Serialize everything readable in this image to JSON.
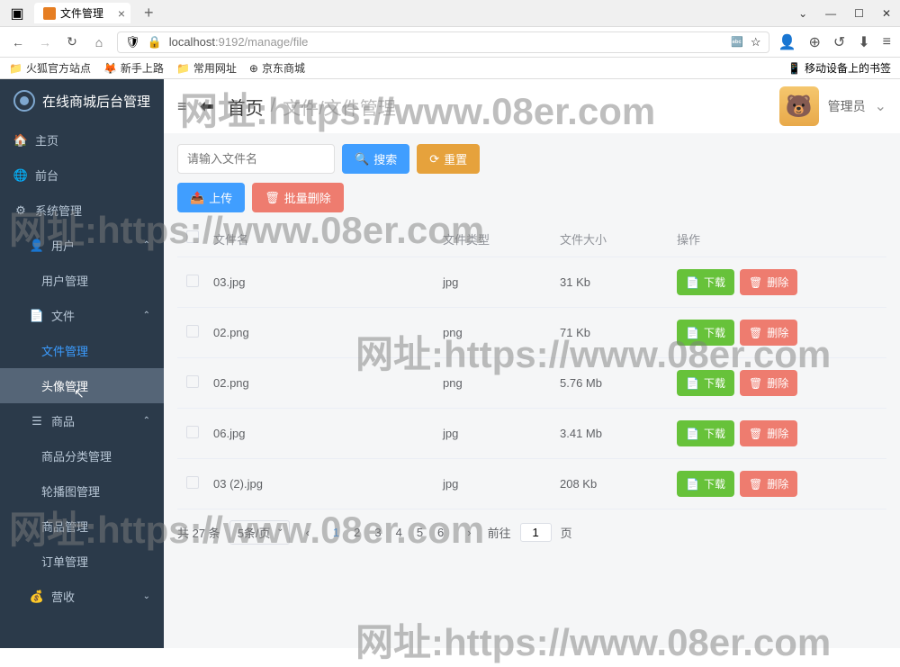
{
  "browser": {
    "tab_title": "文件管理",
    "url_prefix": "localhost",
    "url_suffix": ":9192/manage/file",
    "bookmarks": [
      "火狐官方站点",
      "新手上路",
      "常用网址",
      "京东商城"
    ],
    "bookmark_right": "移动设备上的书签"
  },
  "sidebar": {
    "title": "在线商城后台管理",
    "items": [
      {
        "label": "主页"
      },
      {
        "label": "前台"
      },
      {
        "label": "系统管理"
      },
      {
        "label": "用户",
        "expandable": true
      },
      {
        "label": "用户管理",
        "sub": true
      },
      {
        "label": "文件",
        "expandable": true
      },
      {
        "label": "文件管理",
        "sub": true,
        "active": true
      },
      {
        "label": "头像管理",
        "sub": true,
        "hover": true
      },
      {
        "label": "商品",
        "expandable": true
      },
      {
        "label": "商品分类管理",
        "sub": true
      },
      {
        "label": "轮播图管理",
        "sub": true
      },
      {
        "label": "商品管理",
        "sub": true
      },
      {
        "label": "订单管理",
        "sub": true
      },
      {
        "label": "营收"
      }
    ]
  },
  "topbar": {
    "breadcrumb_home": "首页",
    "breadcrumb_rest": "文件/文件管理",
    "username": "管理员"
  },
  "toolbar": {
    "search_placeholder": "请输入文件名",
    "search_btn": "搜索",
    "reset_btn": "重置",
    "upload_btn": "上传",
    "batch_delete_btn": "批量删除"
  },
  "table": {
    "headers": {
      "name": "文件名",
      "type": "文件类型",
      "size": "文件大小",
      "op": "操作"
    },
    "download_label": "下载",
    "delete_label": "删除",
    "rows": [
      {
        "name": "03.jpg",
        "type": "jpg",
        "size": "31 Kb"
      },
      {
        "name": "02.png",
        "type": "png",
        "size": "71 Kb"
      },
      {
        "name": "02.png",
        "type": "png",
        "size": "5.76 Mb"
      },
      {
        "name": "06.jpg",
        "type": "jpg",
        "size": "3.41 Mb"
      },
      {
        "name": "03 (2).jpg",
        "type": "jpg",
        "size": "208 Kb"
      }
    ]
  },
  "pagination": {
    "total_text": "共 27 条",
    "per_page": "5条/页",
    "pages": [
      "1",
      "2",
      "3",
      "4",
      "5",
      "6"
    ],
    "current": "1",
    "goto_prefix": "前往",
    "goto_val": "1",
    "goto_suffix": "页"
  },
  "watermark": "网址:https://www.08er.com"
}
